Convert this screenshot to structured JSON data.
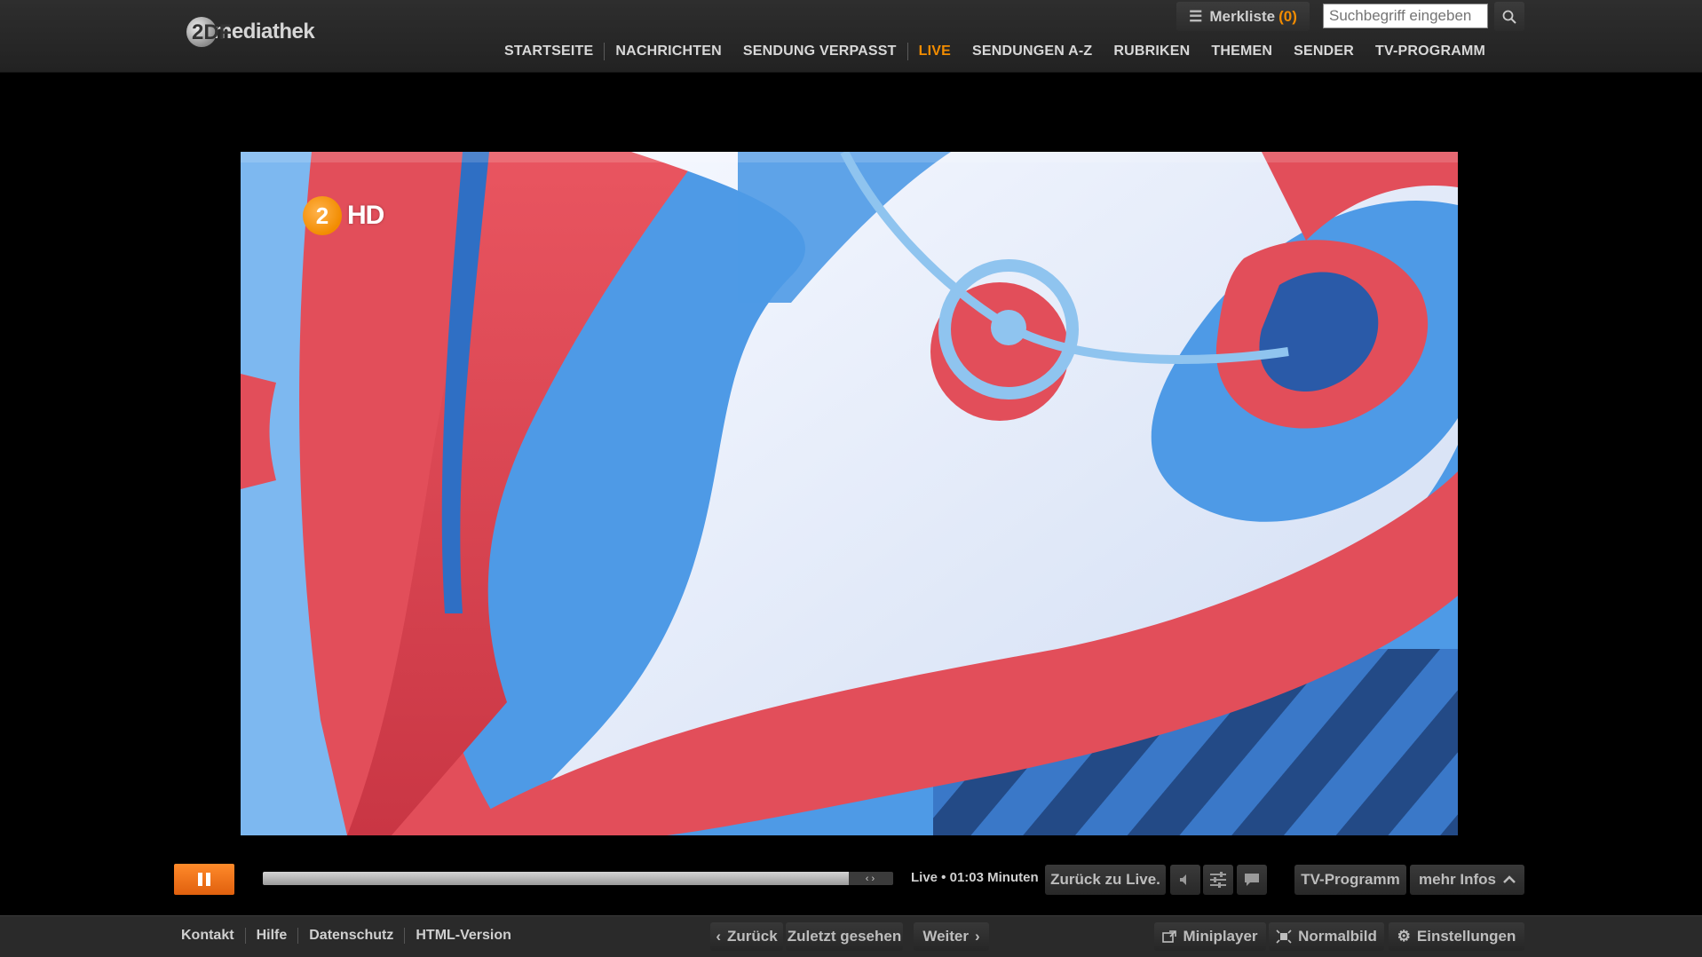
{
  "header": {
    "logo_text": "mediathek",
    "logo_prefix": "2DF",
    "merkliste_label": "Merkliste",
    "merkliste_count": "(0)",
    "search_placeholder": "Suchbegriff eingeben",
    "nav": [
      {
        "label": "STARTSEITE"
      },
      {
        "label": "NACHRICHTEN"
      },
      {
        "label": "SENDUNG VERPASST"
      },
      {
        "label": "LIVE",
        "active": true
      },
      {
        "label": "SENDUNGEN A-Z"
      },
      {
        "label": "RUBRIKEN"
      },
      {
        "label": "THEMEN"
      },
      {
        "label": "SENDER"
      },
      {
        "label": "TV-PROGRAMM"
      }
    ]
  },
  "video": {
    "channel_logo": "2",
    "channel_hd": "HD"
  },
  "controls": {
    "progress_fraction": 0.93,
    "live_status": "Live • 01:03 Minuten",
    "zurueck_live": "Zurück zu Live.",
    "tv_programm": "TV-Programm",
    "mehr_infos": "mehr Infos"
  },
  "footer": {
    "links": [
      "Kontakt",
      "Hilfe",
      "Datenschutz",
      "HTML-Version"
    ],
    "back": "Zurück",
    "last_seen": "Zuletzt gesehen",
    "next": "Weiter",
    "miniplayer": "Miniplayer",
    "normalbild": "Normalbild",
    "einstellungen": "Einstellungen"
  },
  "colors": {
    "accent": "#f28c00",
    "video_red": "#e04a55",
    "video_blue": "#3d8fe0",
    "video_white": "#eef2fb"
  }
}
